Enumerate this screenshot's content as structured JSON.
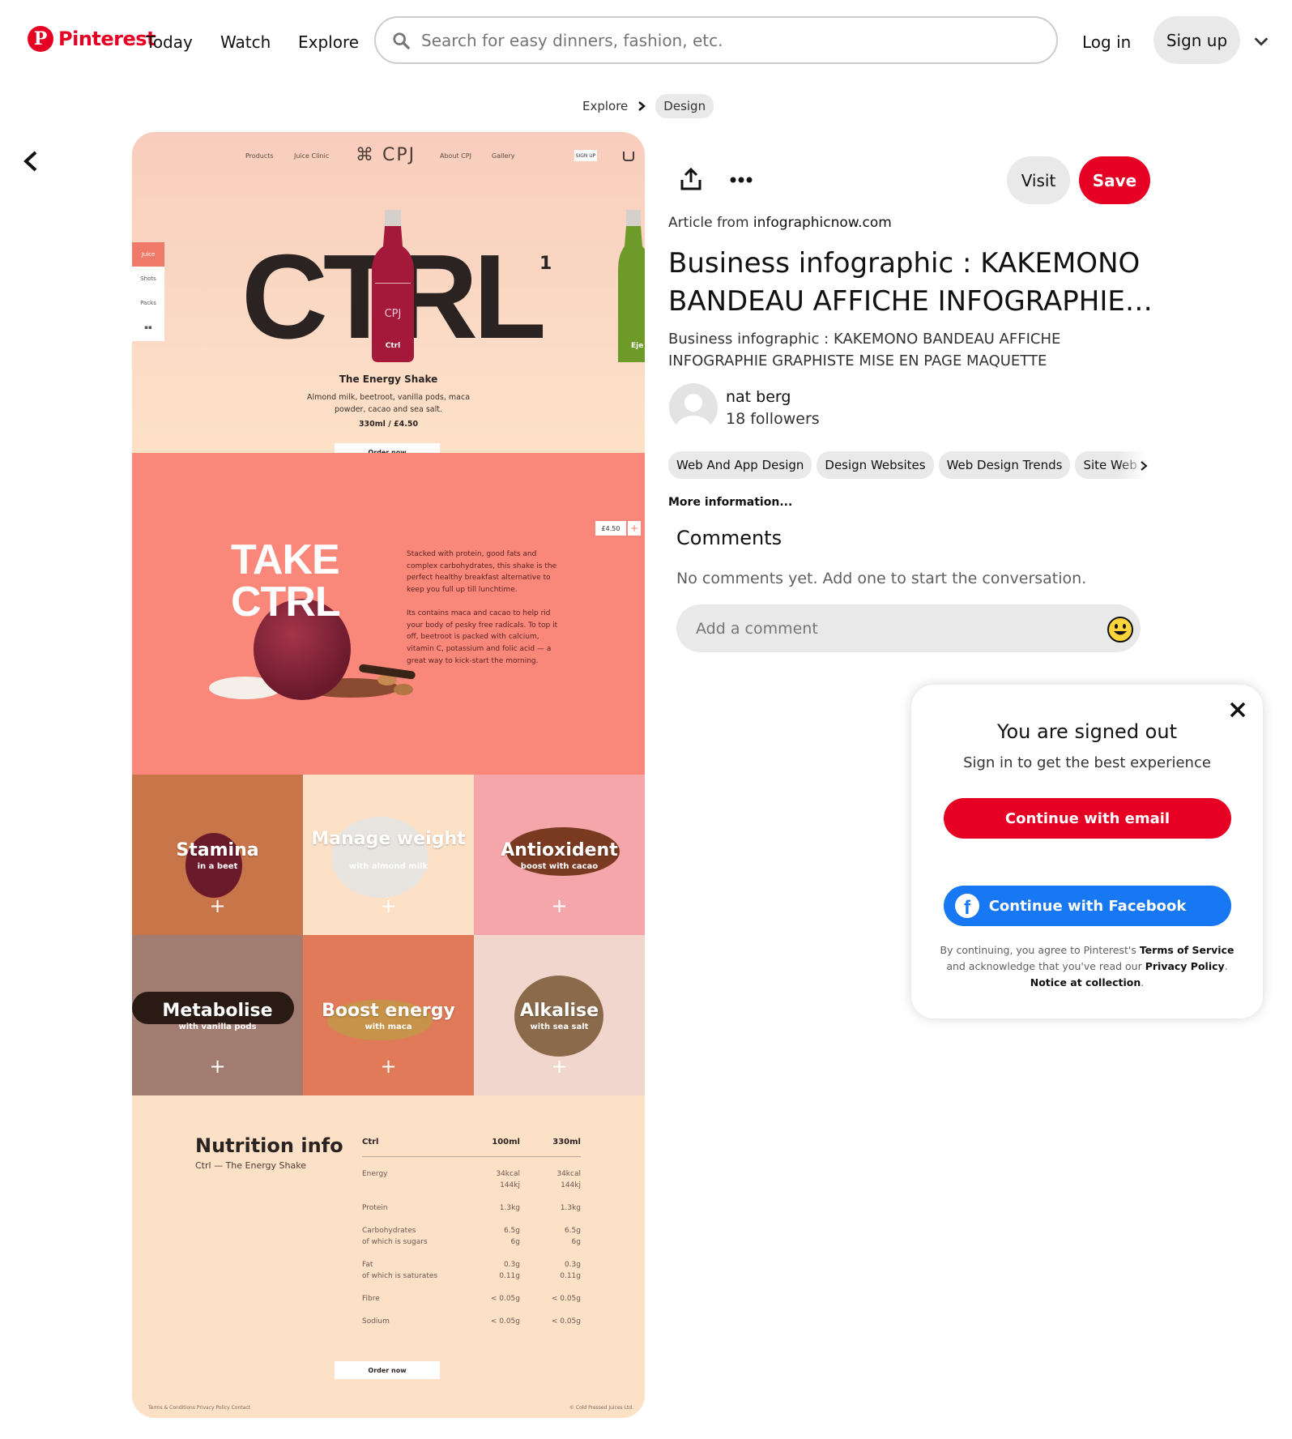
{
  "header": {
    "logo_text": "Pinterest",
    "nav": [
      "Today",
      "Watch",
      "Explore"
    ],
    "search_placeholder": "Search for easy dinners, fashion, etc.",
    "login": "Log in",
    "signup": "Sign up"
  },
  "breadcrumb": {
    "root": "Explore",
    "current": "Design"
  },
  "pin_image": {
    "nav": [
      "Products",
      "Juice Clinic",
      "About CPJ",
      "Gallery"
    ],
    "brand": "⌘ CPJ",
    "signup_mini": "SIGN UP",
    "hero_word": "CTRL",
    "hero_sup": "1",
    "side_tabs": [
      "Juice",
      "Shots",
      "Packs",
      "▪▪"
    ],
    "bottle_brand": "CPJ",
    "bottle_label": "Ctrl",
    "bottle2_label": "Eje",
    "shake_title": "The Energy Shake",
    "shake_desc": "Almond milk, beetroot, vanilla pods, maca powder, cacao and sea salt.",
    "shake_price": "330ml / £4.50",
    "order_label": "Order now",
    "take_ctrl": [
      "TAKE",
      "CTRL"
    ],
    "price_tag": "£4.50",
    "plus": "+",
    "para1": "Stacked with protein, good fats and complex carbohydrates, this shake is the perfect healthy breakfast alternative to keep you full up till lunchtime.",
    "para2": "Its contains maca and cacao to help rid your body of pesky free radicals. To top it off, beetroot is packed with calcium, vitamin C, potassium and folic acid — a great way to kick-start the morning.",
    "cells": [
      {
        "title": "Stamina",
        "sub": "in a beet"
      },
      {
        "title": "Manage weight",
        "sub": "with almond milk"
      },
      {
        "title": "Antioxident",
        "sub": "boost with cacao"
      },
      {
        "title": "Metabolise",
        "sub": "with vanilla pods"
      },
      {
        "title": "Boost energy",
        "sub": "with maca"
      },
      {
        "title": "Alkalise",
        "sub": "with sea salt"
      }
    ],
    "nutrition_title": "Nutrition info",
    "nutrition_sub": "Ctrl — The Energy Shake",
    "nutrition_head": [
      "Ctrl",
      "100ml",
      "330ml"
    ],
    "nutrition_rows": [
      [
        "Energy",
        "34kcal\n144kj",
        "34kcal\n144kj"
      ],
      [
        "Protein",
        "1.3kg",
        "1.3kg"
      ],
      [
        "Carbohydrates\nof which is sugars",
        "6.5g\n6g",
        "6.5g\n6g"
      ],
      [
        "Fat\nof which is saturates",
        "0.3g\n0.11g",
        "0.3g\n0.11g"
      ],
      [
        "Fibre",
        "< 0.05g",
        "< 0.05g"
      ],
      [
        "Sodium",
        "< 0.05g",
        "< 0.05g"
      ]
    ],
    "footer_links": "Terms & Conditions    Privacy Policy    Contact",
    "footer_copy": "© Cold Pressed Juices Ltd."
  },
  "actions": {
    "visit": "Visit",
    "save": "Save"
  },
  "pin": {
    "article_prefix": "Article from ",
    "article_source": "infographicnow.com",
    "title": "Business infographic : KAKEMONO BANDEAU AFFICHE INFOGRAPHIE…",
    "description": "Business infographic : KAKEMONO BANDEAU AFFICHE INFOGRAPHIE GRAPHISTE MISE EN PAGE MAQUETTE",
    "author": "nat berg",
    "followers": "18 followers",
    "tags": [
      "Web And App Design",
      "Design Websites",
      "Web Design Trends",
      "Site Web Design"
    ],
    "more_info": "More information..."
  },
  "comments": {
    "heading": "Comments",
    "empty": "No comments yet. Add one to start the conversation.",
    "placeholder": "Add a comment"
  },
  "modal": {
    "title": "You are signed out",
    "subtitle": "Sign in to get the best experience",
    "email_button": "Continue with email",
    "facebook_button": "Continue with Facebook",
    "legal_1": "By continuing, you agree to Pinterest's ",
    "legal_terms": "Terms of Service",
    "legal_2": " and acknowledge that you've read our ",
    "legal_privacy": "Privacy Policy",
    "legal_3": ". ",
    "legal_notice": "Notice at collection",
    "legal_4": "."
  }
}
